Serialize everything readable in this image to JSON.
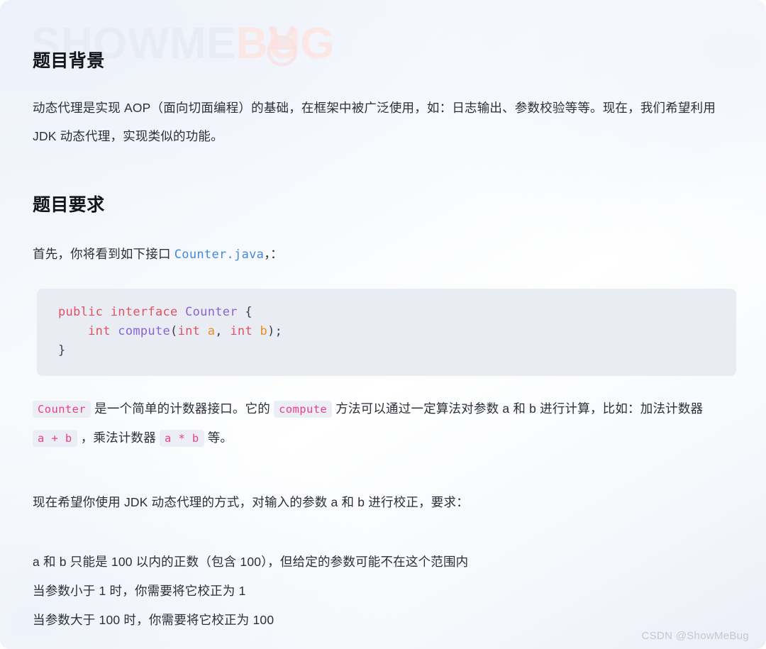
{
  "watermark": {
    "logo_show": "SHOWME",
    "logo_bug": "BUG",
    "bug_icon": "bug-icon"
  },
  "sections": {
    "background": {
      "heading": "题目背景",
      "paragraph": "动态代理是实现 AOP（面向切面编程）的基础，在框架中被广泛使用，如：日志输出、参数校验等等。现在，我们希望利用 JDK 动态代理，实现类似的功能。"
    },
    "requirements": {
      "heading": "题目要求",
      "intro_before": "首先，你将看到如下接口 ",
      "intro_link": "Counter.java",
      "intro_after": "，："
    }
  },
  "code_block": {
    "language": "java",
    "lines": [
      {
        "tokens": [
          {
            "text": "public interface ",
            "type": "kw"
          },
          {
            "text": "Counter",
            "type": "type"
          },
          {
            "text": " {",
            "type": "punc"
          }
        ]
      },
      {
        "tokens": [
          {
            "text": "    ",
            "type": "punc"
          },
          {
            "text": "int",
            "type": "kw"
          },
          {
            "text": " ",
            "type": "punc"
          },
          {
            "text": "compute",
            "type": "fn"
          },
          {
            "text": "(",
            "type": "punc"
          },
          {
            "text": "int",
            "type": "kw"
          },
          {
            "text": " ",
            "type": "punc"
          },
          {
            "text": "a",
            "type": "param"
          },
          {
            "text": ", ",
            "type": "punc"
          },
          {
            "text": "int",
            "type": "kw"
          },
          {
            "text": " ",
            "type": "punc"
          },
          {
            "text": "b",
            "type": "param"
          },
          {
            "text": ");",
            "type": "punc"
          }
        ]
      },
      {
        "tokens": [
          {
            "text": "}",
            "type": "punc"
          }
        ]
      }
    ]
  },
  "description": {
    "part1_code": "Counter",
    "part2_text": " 是一个简单的计数器接口。它的 ",
    "part3_code": "compute",
    "part4_text": " 方法可以通过一定算法对参数 a 和 b 进行计算，比如：加法计数器 ",
    "part5_code": "a + b",
    "part6_text": " ，乘法计数器 ",
    "part7_code": "a * b",
    "part8_text": " 等。"
  },
  "proxy_paragraph": "现在希望你使用 JDK 动态代理的方式，对输入的参数 a 和 b 进行校正，要求：",
  "requirement_lines": [
    "a 和 b 只能是 100 以内的正数（包含 100），但给定的参数可能不在这个范围内",
    "当参数小于 1 时，你需要将它校正为 1",
    "当参数大于 100 时，你需要将它校正为 100"
  ],
  "csdn_watermark": "CSDN @ShowMeBug",
  "colors": {
    "link": "#3f8ae0",
    "inline_code_text": "#ec3f86",
    "inline_code_bg": "#eceef5",
    "code_block_bg": "#e9ecf3",
    "keyword": "#e05263",
    "type": "#8a63d2",
    "param": "#f08a24",
    "heading": "#13151a",
    "body_text": "#2b2f38"
  }
}
